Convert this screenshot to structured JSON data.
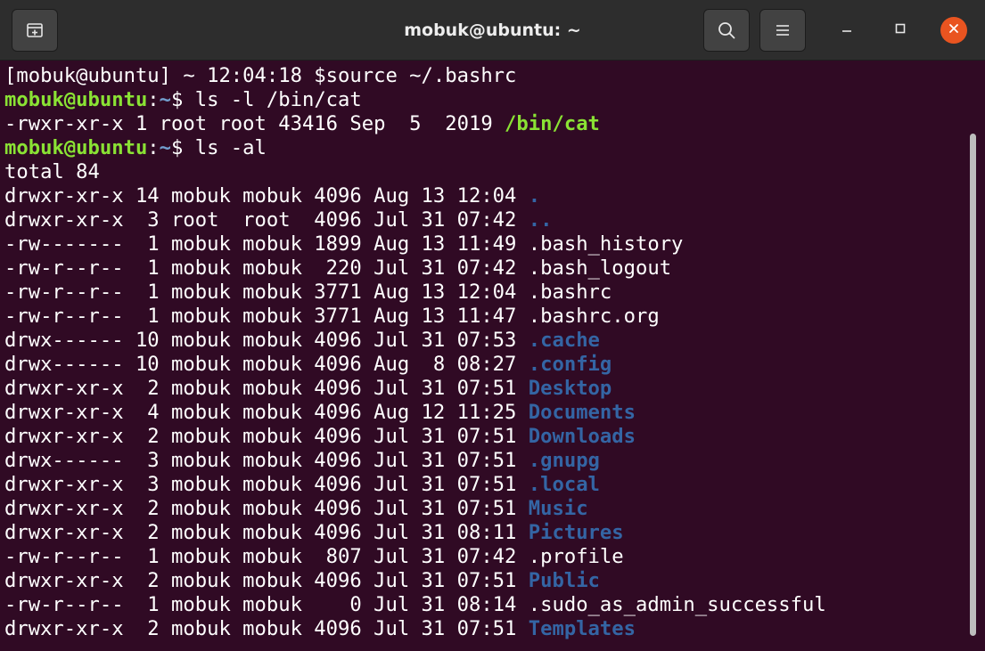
{
  "window": {
    "title": "mobuk@ubuntu: ~"
  },
  "icons": {
    "new_tab": "new-tab-icon",
    "search": "search-icon",
    "menu": "hamburger-menu-icon",
    "minimize": "minimize-icon",
    "maximize": "maximize-icon",
    "close": "close-icon"
  },
  "colors": {
    "terminal_bg": "#300a24",
    "prompt_user": "#8ae234",
    "prompt_path": "#729fcf",
    "directory": "#3465a4",
    "executable": "#8ae234",
    "close_button": "#e95420"
  },
  "terminal": {
    "line0": "[mobuk@ubuntu] ~ 12:04:18 $source ~/.bashrc",
    "prompt1": {
      "user": "mobuk@ubuntu",
      "sep": ":",
      "path": "~",
      "dollar": "$ ",
      "command": "ls -l /bin/cat"
    },
    "cat_line": {
      "meta": "-rwxr-xr-x 1 root root 43416 Sep  5  2019 ",
      "name": "/bin/cat"
    },
    "prompt2": {
      "user": "mobuk@ubuntu",
      "sep": ":",
      "path": "~",
      "dollar": "$ ",
      "command": "ls -al"
    },
    "total": "total 84",
    "listing": [
      {
        "meta": "drwxr-xr-x 14 mobuk mobuk 4096 Aug 13 12:04 ",
        "name": ".",
        "type": "dir"
      },
      {
        "meta": "drwxr-xr-x  3 root  root  4096 Jul 31 07:42 ",
        "name": "..",
        "type": "dir"
      },
      {
        "meta": "-rw-------  1 mobuk mobuk 1899 Aug 13 11:49 ",
        "name": ".bash_history",
        "type": "file"
      },
      {
        "meta": "-rw-r--r--  1 mobuk mobuk  220 Jul 31 07:42 ",
        "name": ".bash_logout",
        "type": "file"
      },
      {
        "meta": "-rw-r--r--  1 mobuk mobuk 3771 Aug 13 12:04 ",
        "name": ".bashrc",
        "type": "file"
      },
      {
        "meta": "-rw-r--r--  1 mobuk mobuk 3771 Aug 13 11:47 ",
        "name": ".bashrc.org",
        "type": "file"
      },
      {
        "meta": "drwx------ 10 mobuk mobuk 4096 Jul 31 07:53 ",
        "name": ".cache",
        "type": "dir"
      },
      {
        "meta": "drwx------ 10 mobuk mobuk 4096 Aug  8 08:27 ",
        "name": ".config",
        "type": "dir"
      },
      {
        "meta": "drwxr-xr-x  2 mobuk mobuk 4096 Jul 31 07:51 ",
        "name": "Desktop",
        "type": "dir"
      },
      {
        "meta": "drwxr-xr-x  4 mobuk mobuk 4096 Aug 12 11:25 ",
        "name": "Documents",
        "type": "dir"
      },
      {
        "meta": "drwxr-xr-x  2 mobuk mobuk 4096 Jul 31 07:51 ",
        "name": "Downloads",
        "type": "dir"
      },
      {
        "meta": "drwx------  3 mobuk mobuk 4096 Jul 31 07:51 ",
        "name": ".gnupg",
        "type": "dir"
      },
      {
        "meta": "drwxr-xr-x  3 mobuk mobuk 4096 Jul 31 07:51 ",
        "name": ".local",
        "type": "dir"
      },
      {
        "meta": "drwxr-xr-x  2 mobuk mobuk 4096 Jul 31 07:51 ",
        "name": "Music",
        "type": "dir"
      },
      {
        "meta": "drwxr-xr-x  2 mobuk mobuk 4096 Jul 31 08:11 ",
        "name": "Pictures",
        "type": "dir"
      },
      {
        "meta": "-rw-r--r--  1 mobuk mobuk  807 Jul 31 07:42 ",
        "name": ".profile",
        "type": "file"
      },
      {
        "meta": "drwxr-xr-x  2 mobuk mobuk 4096 Jul 31 07:51 ",
        "name": "Public",
        "type": "dir"
      },
      {
        "meta": "-rw-r--r--  1 mobuk mobuk    0 Jul 31 08:14 ",
        "name": ".sudo_as_admin_successful",
        "type": "file"
      },
      {
        "meta": "drwxr-xr-x  2 mobuk mobuk 4096 Jul 31 07:51 ",
        "name": "Templates",
        "type": "dir"
      }
    ]
  }
}
